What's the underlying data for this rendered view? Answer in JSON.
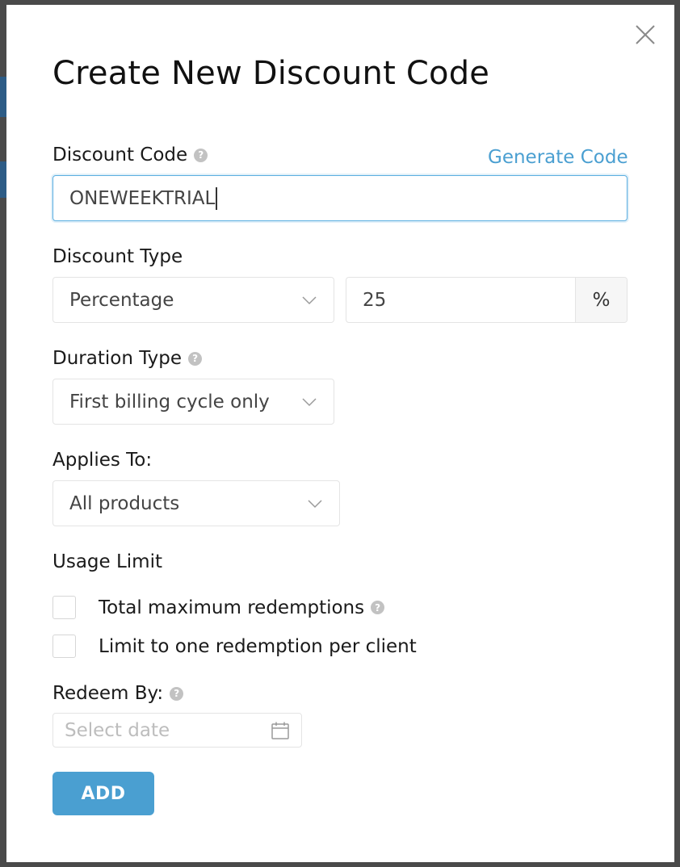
{
  "dialog": {
    "title": "Create New Discount Code",
    "close_icon": "close-icon"
  },
  "discount_code": {
    "label": "Discount Code",
    "generate_link": "Generate Code",
    "value": "ONEWEEKTRIAL"
  },
  "discount_type": {
    "label": "Discount Type",
    "selected": "Percentage",
    "amount": "25",
    "suffix": "%"
  },
  "duration_type": {
    "label": "Duration Type",
    "selected": "First billing cycle only"
  },
  "applies_to": {
    "label": "Applies To:",
    "selected": "All products"
  },
  "usage_limit": {
    "label": "Usage Limit",
    "options": [
      {
        "label": "Total maximum redemptions",
        "checked": false
      },
      {
        "label": "Limit to one redemption per client",
        "checked": false
      }
    ]
  },
  "redeem_by": {
    "label": "Redeem By:",
    "placeholder": "Select date"
  },
  "submit": {
    "label": "ADD"
  },
  "colors": {
    "accent": "#4a9fd1",
    "focus_border": "#5aaee0",
    "help_icon": "#c2c2c2"
  }
}
